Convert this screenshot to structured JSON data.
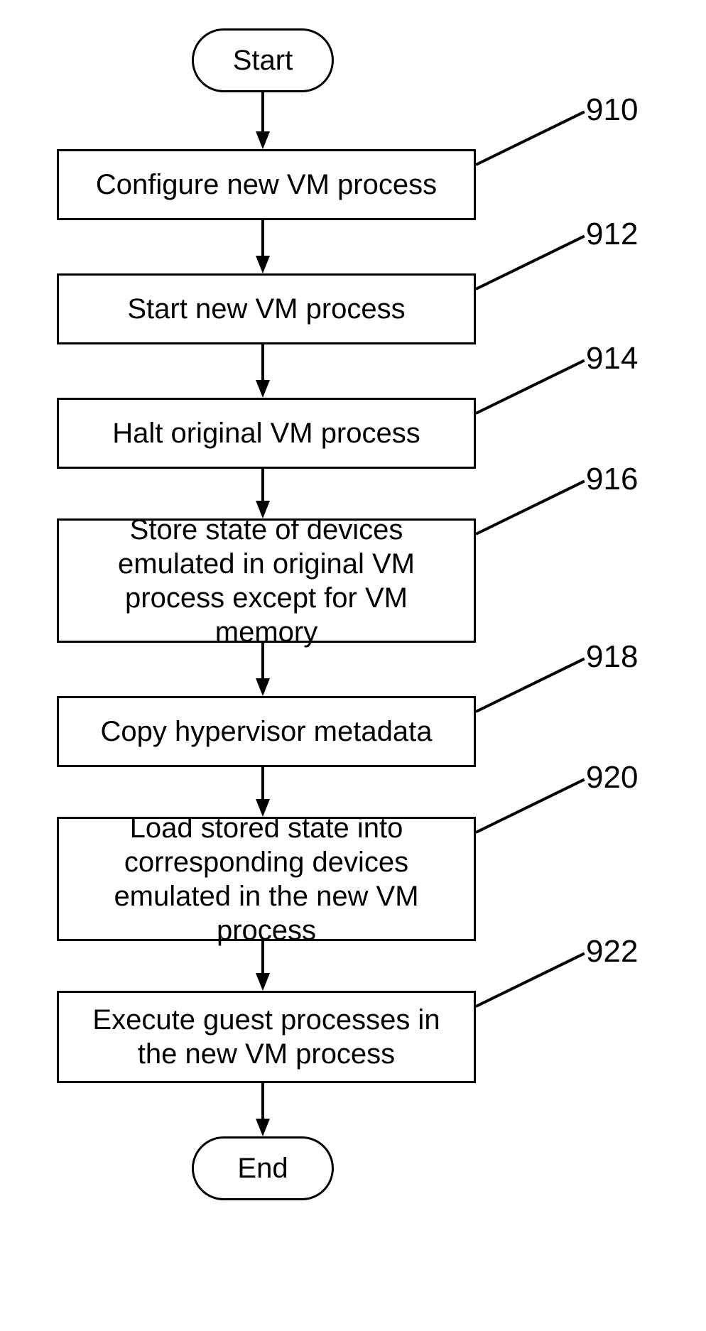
{
  "flowchart": {
    "start": "Start",
    "end": "End",
    "steps": [
      {
        "id": "910",
        "text": "Configure new VM process"
      },
      {
        "id": "912",
        "text": "Start new VM process"
      },
      {
        "id": "914",
        "text": "Halt original VM process"
      },
      {
        "id": "916",
        "text": "Store state of devices emulated in original VM process except for VM memory"
      },
      {
        "id": "918",
        "text": "Copy hypervisor metadata"
      },
      {
        "id": "920",
        "text": "Load stored state into corresponding devices emulated in the new VM process"
      },
      {
        "id": "922",
        "text": "Execute guest processes in the new VM process"
      }
    ]
  }
}
